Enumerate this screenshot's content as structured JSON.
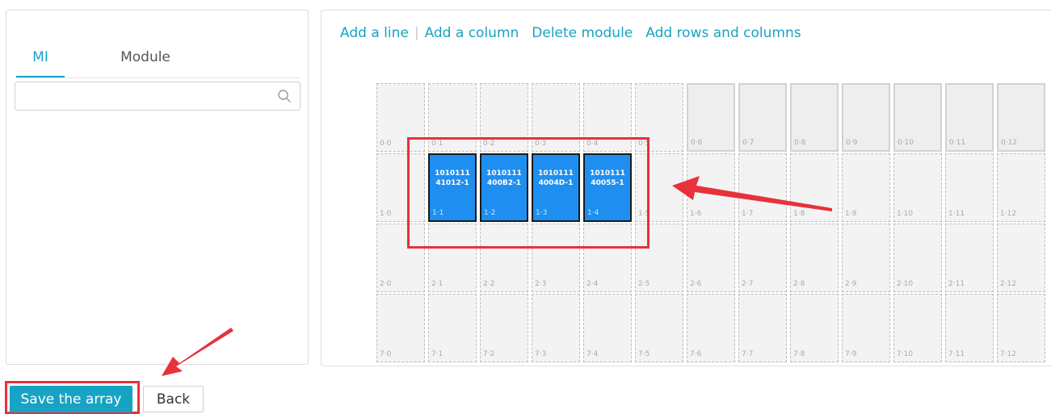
{
  "tabs": [
    {
      "label": "MI",
      "active": true
    },
    {
      "label": "Module",
      "active": false
    }
  ],
  "search": {
    "value": "",
    "placeholder": ""
  },
  "toolbar": {
    "add_line": "Add a line",
    "separator": "|",
    "add_column": "Add a column",
    "delete_module": "Delete module",
    "add_rows_columns": "Add rows and columns"
  },
  "grid": {
    "rows": [
      "0",
      "1",
      "2",
      "7"
    ],
    "columns": 13,
    "cells": [
      [
        "0·0",
        "0·1",
        "0·2",
        "0·3",
        "0·4",
        "0·5",
        "0·6",
        "0·7",
        "0·8",
        "0·9",
        "0·10",
        "0·11",
        "0·12"
      ],
      [
        "1·0",
        "1·1",
        "1·2",
        "1·3",
        "1·4",
        "1·5",
        "1·6",
        "1·7",
        "1·8",
        "1·9",
        "1·10",
        "1·11",
        "1·12"
      ],
      [
        "2·0",
        "2·1",
        "2·2",
        "2·3",
        "2·4",
        "2·5",
        "2·6",
        "2·7",
        "2·8",
        "2·9",
        "2·10",
        "2·11",
        "2·12"
      ],
      [
        "7·0",
        "7·1",
        "7·2",
        "7·3",
        "7·4",
        "7·5",
        "7·6",
        "7·7",
        "7·8",
        "7·9",
        "7·10",
        "7·11",
        "7·12"
      ]
    ],
    "solid_cells": [
      "0·6",
      "0·7",
      "0·8",
      "0·9",
      "0·10",
      "0·11",
      "0·12"
    ],
    "modules": [
      {
        "cell": "1·1",
        "line1": "1010111",
        "line2": "41012-1"
      },
      {
        "cell": "1·2",
        "line1": "1010111",
        "line2": "400B2-1"
      },
      {
        "cell": "1·3",
        "line1": "1010111",
        "line2": "4004D-1"
      },
      {
        "cell": "1·4",
        "line1": "1010111",
        "line2": "40055-1"
      }
    ]
  },
  "buttons": {
    "save": "Save the array",
    "back": "Back"
  },
  "colors": {
    "accent": "#17a3c4",
    "module_fill": "#1e8ff0",
    "annotation": "#e8313b"
  }
}
